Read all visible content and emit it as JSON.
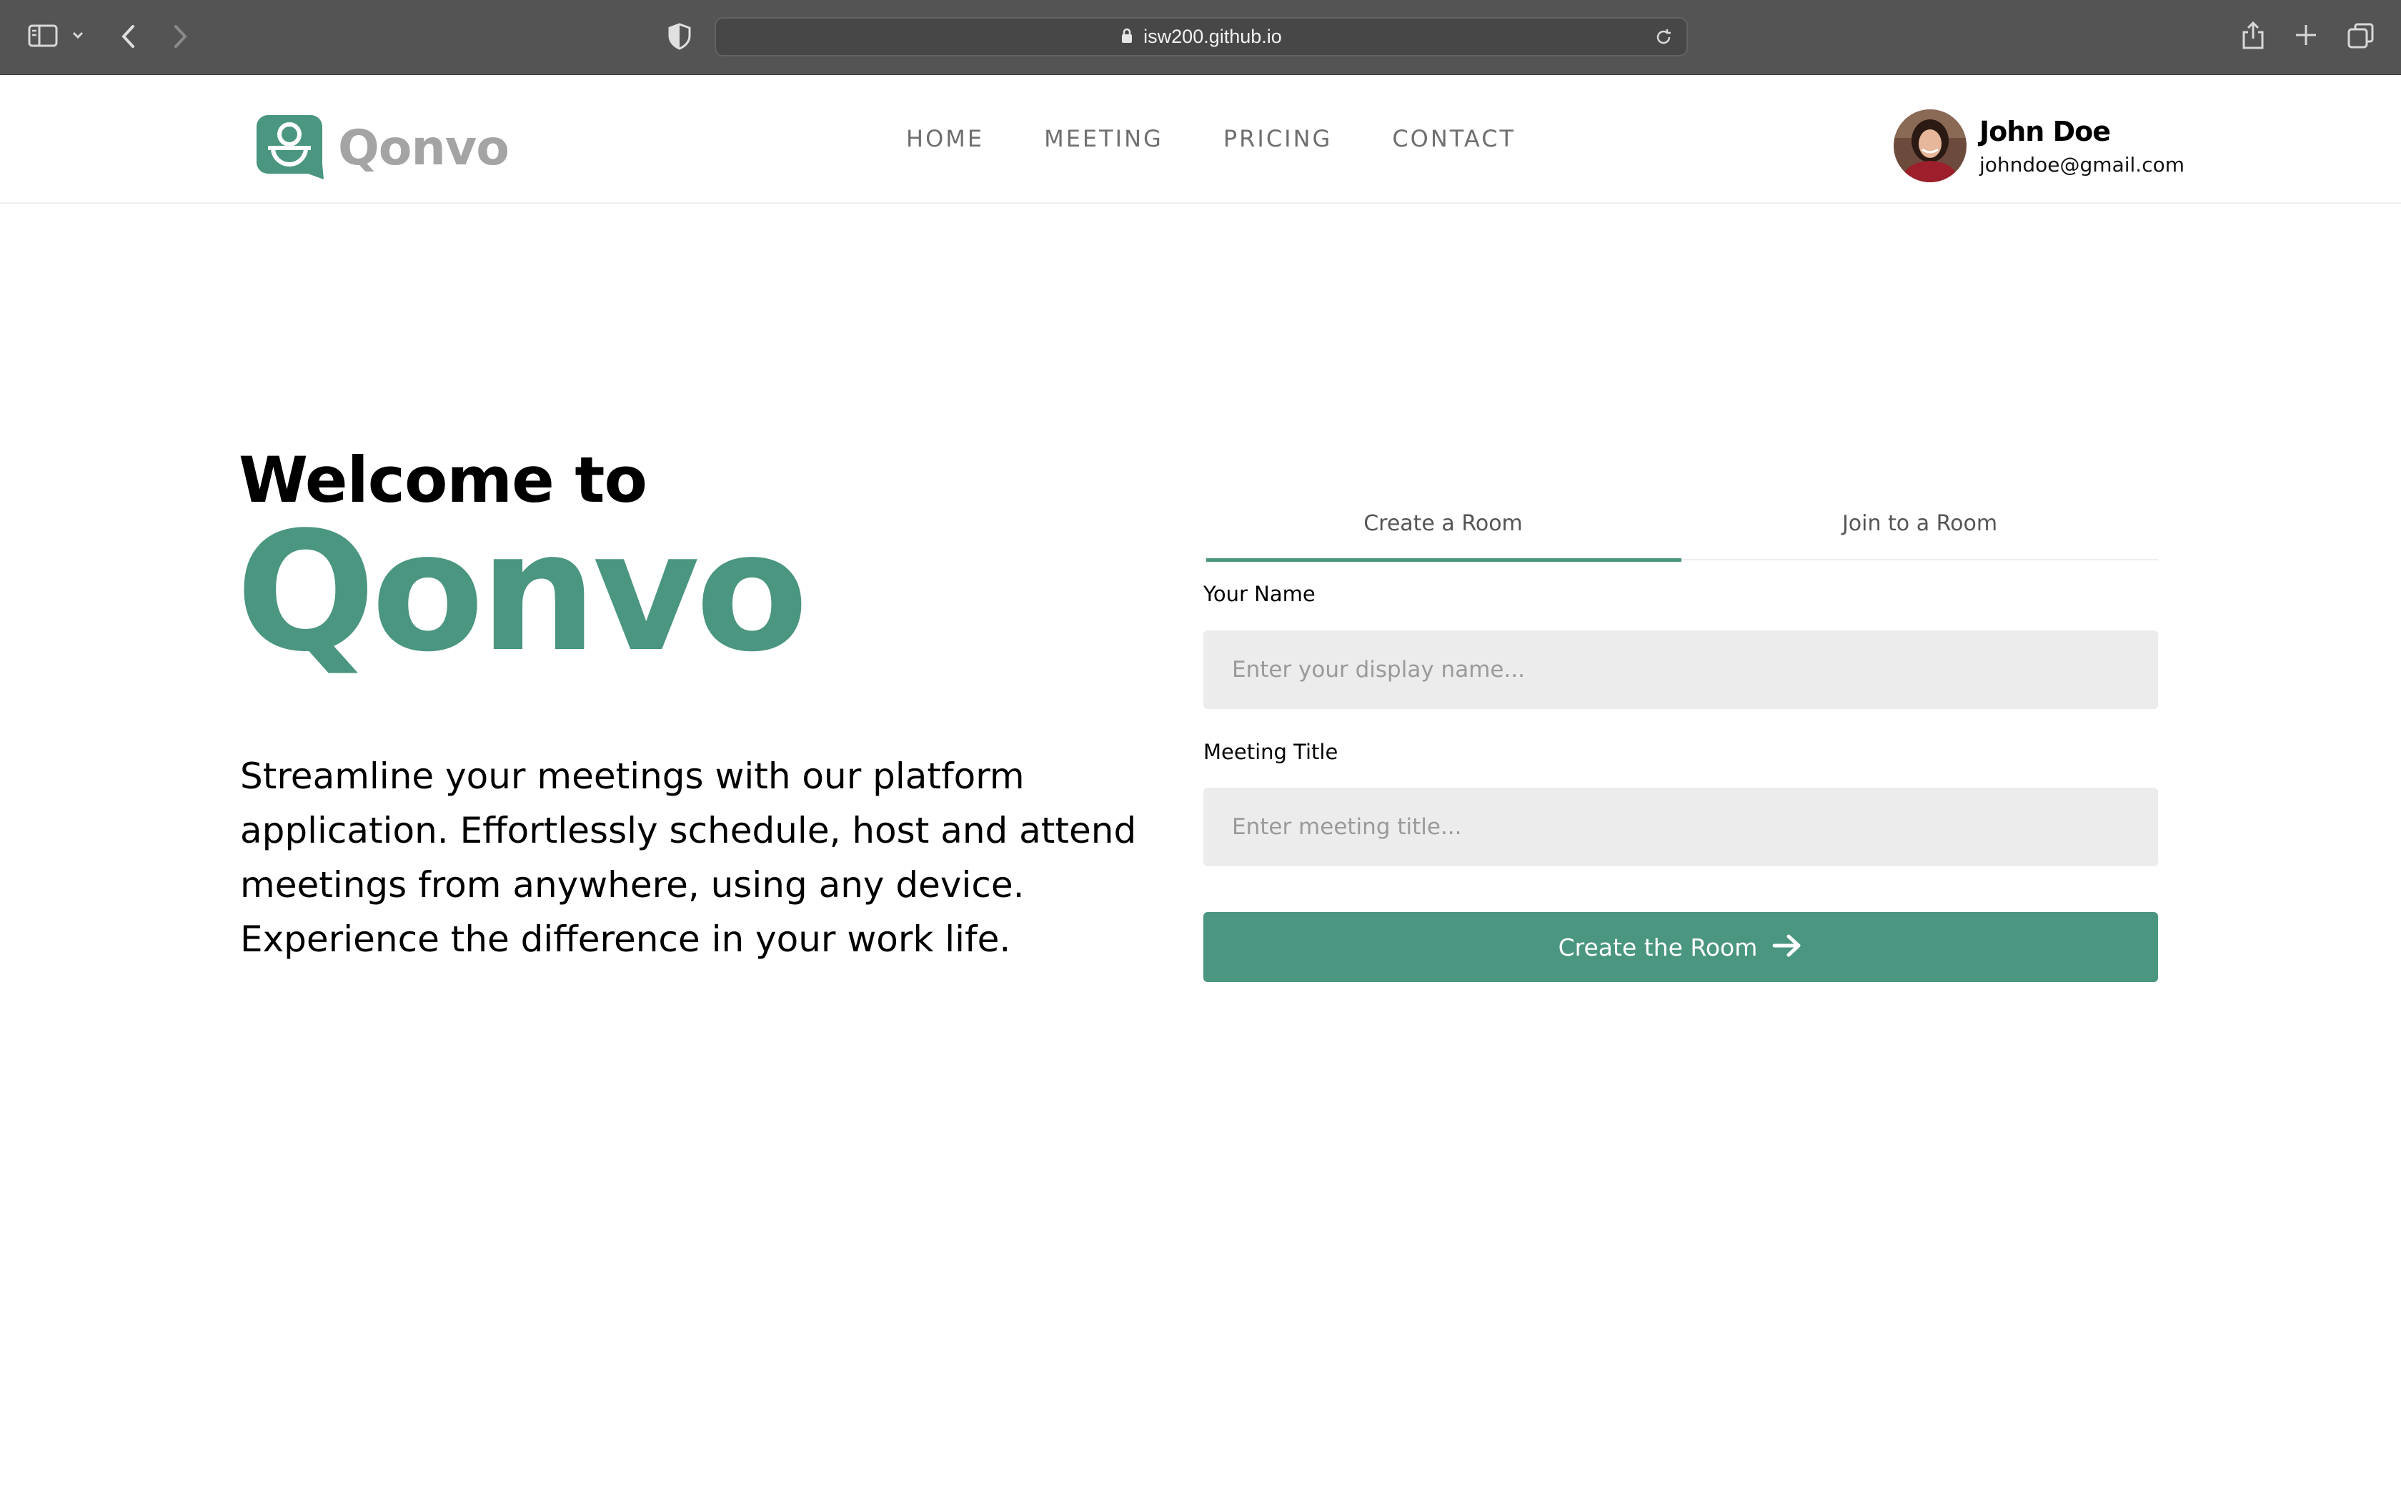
{
  "browser": {
    "url": "isw200.github.io",
    "icons": [
      "sidebar-toggle-icon",
      "chevron-down-icon",
      "back-arrow-icon",
      "forward-arrow-icon",
      "privacy-shield-icon",
      "lock-icon",
      "reload-icon",
      "share-icon",
      "new-tab-icon",
      "tab-overview-icon"
    ]
  },
  "header": {
    "brand": "Qonvo",
    "nav": [
      "HOME",
      "MEETING",
      "PRICING",
      "CONTACT"
    ],
    "user": {
      "name": "John Doe",
      "email": "johndoe@gmail.com"
    }
  },
  "hero": {
    "welcome": "Welcome to",
    "brand": "Qonvo",
    "description": "Streamline your meetings with our platform application. Effortlessly schedule, host and attend meetings from anywhere, using any device. Experience the difference in your work life."
  },
  "form": {
    "tabs": [
      "Create a Room",
      "Join to a Room"
    ],
    "active_tab": "Create a Room",
    "name_label": "Your Name",
    "name_placeholder": "Enter your display name...",
    "title_label": "Meeting Title",
    "title_placeholder": "Enter meeting title...",
    "submit_label": "Create the Room"
  },
  "colors": {
    "brand": "#4a9680",
    "brand_muted": "#a4a4a4",
    "chrome": "#545454",
    "input_bg": "#ececec"
  }
}
